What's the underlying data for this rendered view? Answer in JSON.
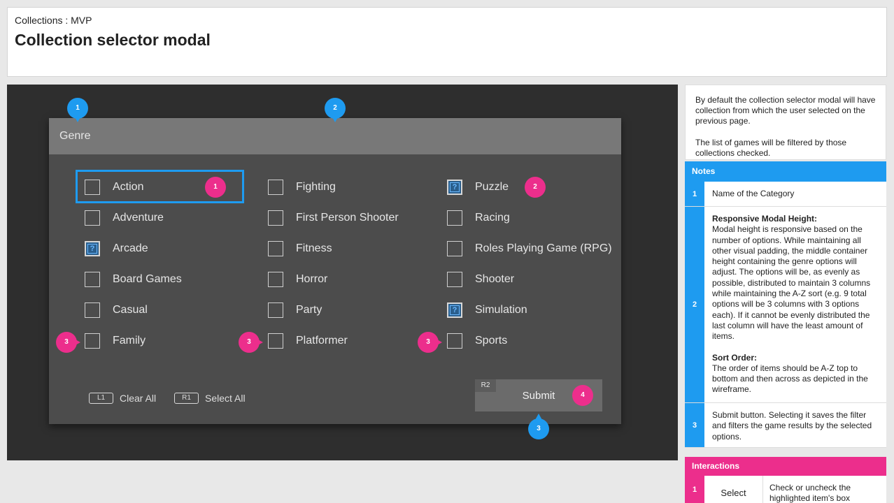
{
  "header": {
    "breadcrumb": "Collections : MVP",
    "title": "Collection selector modal"
  },
  "modal": {
    "title": "Genre",
    "columns": [
      [
        {
          "label": "Action",
          "checked": false
        },
        {
          "label": "Adventure",
          "checked": false
        },
        {
          "label": "Arcade",
          "checked": true
        },
        {
          "label": "Board Games",
          "checked": false
        },
        {
          "label": "Casual",
          "checked": false
        },
        {
          "label": "Family",
          "checked": false
        }
      ],
      [
        {
          "label": "Fighting",
          "checked": false
        },
        {
          "label": "First Person Shooter",
          "checked": false
        },
        {
          "label": "Fitness",
          "checked": false
        },
        {
          "label": "Horror",
          "checked": false
        },
        {
          "label": "Party",
          "checked": false
        },
        {
          "label": "Platformer",
          "checked": false
        }
      ],
      [
        {
          "label": "Puzzle",
          "checked": true
        },
        {
          "label": "Racing",
          "checked": false
        },
        {
          "label": "Roles Playing Game (RPG)",
          "checked": false
        },
        {
          "label": "Shooter",
          "checked": false
        },
        {
          "label": "Simulation",
          "checked": true
        },
        {
          "label": "Sports",
          "checked": false
        }
      ]
    ],
    "checked_glyph": "?",
    "clear_key": "L1",
    "clear_label": "Clear All",
    "select_key": "R1",
    "select_label": "Select All",
    "submit_key": "R2",
    "submit_label": "Submit"
  },
  "annotations": {
    "blue_1": "1",
    "blue_2": "2",
    "blue_3": "3",
    "pink_1": "1",
    "pink_2": "2",
    "pink_3": "3",
    "pink_4": "4"
  },
  "side_panel": {
    "intro_p1": "By default the collection selector modal will have collection from which the user selected on the previous page.",
    "intro_p2": "The list of games will be filtered by those collections checked.",
    "notes_title": "Notes",
    "notes": [
      {
        "num": "1",
        "text": "Name of the Category"
      },
      {
        "num": "2",
        "heading1": "Responsive Modal Height:",
        "text1": "Modal height is responsive based on the number of options. While maintaining all other visual padding, the middle container height containing the genre options will adjust. The options will be, as evenly as possible, distributed to maintain 3 columns while maintaining the A-Z sort (e.g. 9 total options will be 3 columns with 3 options each). If it cannot be evenly distributed the last column will have the least amount of items.",
        "heading2": "Sort Order:",
        "text2": "The order of items should be A-Z top to bottom and then across as depicted in the wireframe."
      },
      {
        "num": "3",
        "text": "Submit button. Selecting it saves the filter and filters the game results by the selected options."
      }
    ],
    "interactions_title": "Interactions",
    "interactions": [
      {
        "num": "1",
        "action": "Select",
        "description": "Check or uncheck the highlighted item's box"
      }
    ]
  },
  "colors": {
    "accent_blue": "#1e9bf0",
    "accent_pink": "#ec2e8c",
    "stage_bg": "#2e2e2e",
    "modal_bg": "#4c4c4c",
    "modal_header_bg": "#787878"
  }
}
